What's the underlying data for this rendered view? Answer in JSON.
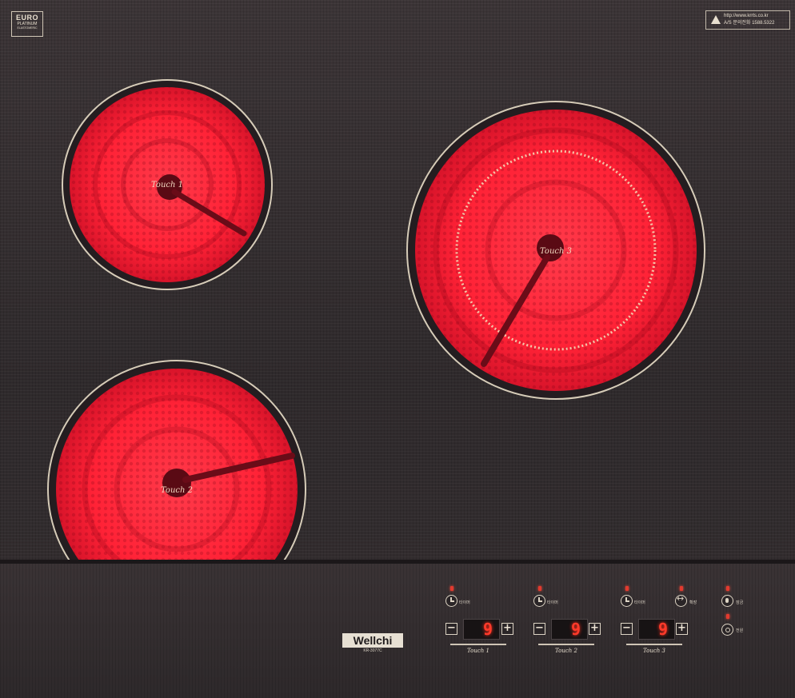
{
  "badge": {
    "line1": "EURO",
    "line2": "PLATINUM",
    "line3": "ELASTOMERIC"
  },
  "warning": {
    "line1": "http://www.krrts.co.kr",
    "line2": "A/S 문의전화 1588.5322"
  },
  "burners": [
    {
      "label": "Touch 1"
    },
    {
      "label": "Touch 2"
    },
    {
      "label": "Touch 3"
    }
  ],
  "brand": {
    "logo": "Wellchi",
    "model": "KR-3077C"
  },
  "controls": {
    "timer_label": "타이머",
    "expand_label": "확장",
    "lock_label": "잠금",
    "power_label": "전원",
    "minus": "−",
    "plus": "+",
    "zones": [
      {
        "level": "9",
        "label": "Touch 1"
      },
      {
        "level": "9",
        "label": "Touch 2"
      },
      {
        "level": "9",
        "label": "Touch 3"
      }
    ]
  },
  "colors": {
    "glass": "#322c2e",
    "heat": "#ff2a3a",
    "ring": "#d6ccb8",
    "led": "#e23a2e"
  }
}
